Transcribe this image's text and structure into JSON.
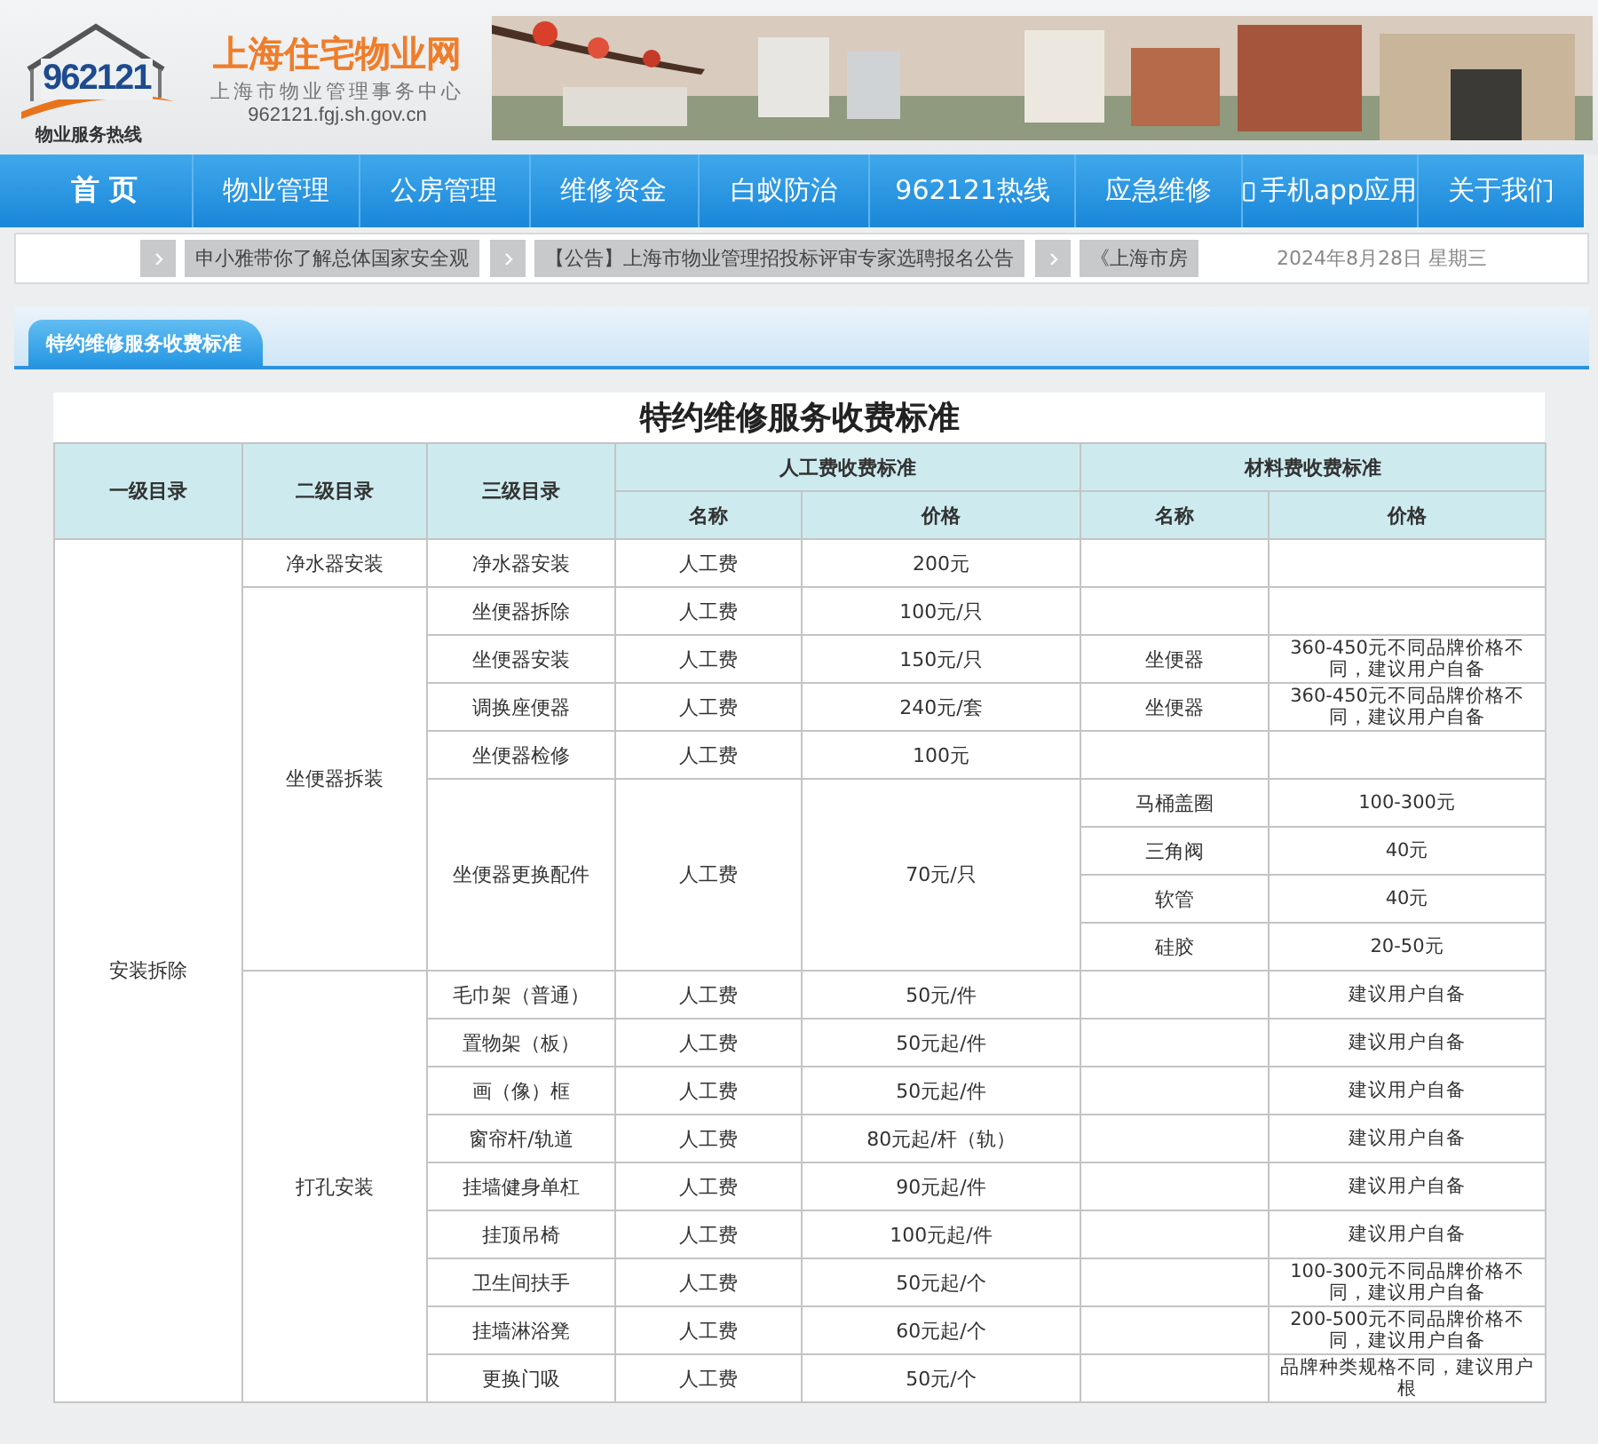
{
  "header": {
    "logo_number": "962121",
    "logo_caption": "物业服务热线",
    "site_name": "上海住宅物业网",
    "org_name": "上海市物业管理事务中心",
    "domain": "962121.fgj.sh.gov.cn"
  },
  "nav": [
    {
      "label": "首 页",
      "kind": "text"
    },
    {
      "label": "物业管理",
      "kind": "text"
    },
    {
      "label": "公房管理",
      "kind": "text"
    },
    {
      "label": "维修资金",
      "kind": "text"
    },
    {
      "label": "白蚁防治",
      "kind": "text"
    },
    {
      "label": "962121热线",
      "kind": "text"
    },
    {
      "label": "应急维修",
      "kind": "text"
    },
    {
      "label": "手机app应用",
      "kind": "app"
    },
    {
      "label": "关于我们",
      "kind": "text"
    }
  ],
  "ticker": {
    "items": [
      "申小雅带你了解总体国家安全观",
      "【公告】上海市物业管理招投标评审专家选聘报名公告",
      "《上海市房"
    ],
    "date": "2024年8月28日 星期三"
  },
  "tab": "特约维修服务收费标准",
  "table": {
    "title": "特约维修服务收费标准",
    "columns": [
      "一级目录",
      "二级目录",
      "三级目录"
    ],
    "groups": [
      {
        "label": "人工费收费标准",
        "columns": [
          "名称",
          "价格"
        ]
      },
      {
        "label": "材料费收费标准",
        "columns": [
          "名称",
          "价格"
        ]
      }
    ],
    "sections": [
      {
        "level1": "安装拆除",
        "subsections": [
          {
            "level2": "净水器安装",
            "items": [
              {
                "level3": "净水器安装",
                "labor": "人工费",
                "price": "200元"
              }
            ]
          },
          {
            "level2": "坐便器拆装",
            "items": [
              {
                "level3": "坐便器拆除",
                "labor": "人工费",
                "price": "100元/只"
              },
              {
                "level3": "坐便器安装",
                "labor": "人工费",
                "price": "150元/只",
                "materials": [
                  {
                    "name": "坐便器",
                    "price": "360-450元不同品牌价格不同，建议用户自备"
                  }
                ]
              },
              {
                "level3": "调换座便器",
                "labor": "人工费",
                "price": "240元/套",
                "materials": [
                  {
                    "name": "坐便器",
                    "price": "360-450元不同品牌价格不同，建议用户自备"
                  }
                ]
              },
              {
                "level3": "坐便器检修",
                "labor": "人工费",
                "price": "100元"
              },
              {
                "level3": "坐便器更换配件",
                "labor": "人工费",
                "price": "70元/只",
                "materials": [
                  {
                    "name": "马桶盖圈",
                    "price": "100-300元"
                  },
                  {
                    "name": "三角阀",
                    "price": "40元"
                  },
                  {
                    "name": "软管",
                    "price": "40元"
                  },
                  {
                    "name": "硅胶",
                    "price": "20-50元"
                  }
                ]
              }
            ]
          },
          {
            "level2": "打孔安装",
            "items": [
              {
                "level3": "毛巾架（普通）",
                "labor": "人工费",
                "price": "50元/件",
                "materials": [
                  {
                    "price": "建议用户自备"
                  }
                ]
              },
              {
                "level3": "置物架（板）",
                "labor": "人工费",
                "price": "50元起/件",
                "materials": [
                  {
                    "price": "建议用户自备"
                  }
                ]
              },
              {
                "level3": "画（像）框",
                "labor": "人工费",
                "price": "50元起/件",
                "materials": [
                  {
                    "price": "建议用户自备"
                  }
                ]
              },
              {
                "level3": "窗帘杆/轨道",
                "labor": "人工费",
                "price": "80元起/杆（轨）",
                "materials": [
                  {
                    "price": "建议用户自备"
                  }
                ]
              },
              {
                "level3": "挂墙健身单杠",
                "labor": "人工费",
                "price": "90元起/件",
                "materials": [
                  {
                    "price": "建议用户自备"
                  }
                ]
              },
              {
                "level3": "挂顶吊椅",
                "labor": "人工费",
                "price": "100元起/件",
                "materials": [
                  {
                    "price": "建议用户自备"
                  }
                ]
              },
              {
                "level3": "卫生间扶手",
                "labor": "人工费",
                "price": "50元起/个",
                "materials": [
                  {
                    "price": "100-300元不同品牌价格不同，建议用户自备"
                  }
                ]
              },
              {
                "level3": "挂墙淋浴凳",
                "labor": "人工费",
                "price": "60元起/个",
                "materials": [
                  {
                    "price": "200-500元不同品牌价格不同，建议用户自备"
                  }
                ]
              },
              {
                "level3": "更换门吸",
                "labor": "人工费",
                "price": "50元/个",
                "materials": [
                  {
                    "price": "品牌种类规格不同，建议用户根"
                  }
                ]
              }
            ]
          }
        ]
      }
    ]
  }
}
